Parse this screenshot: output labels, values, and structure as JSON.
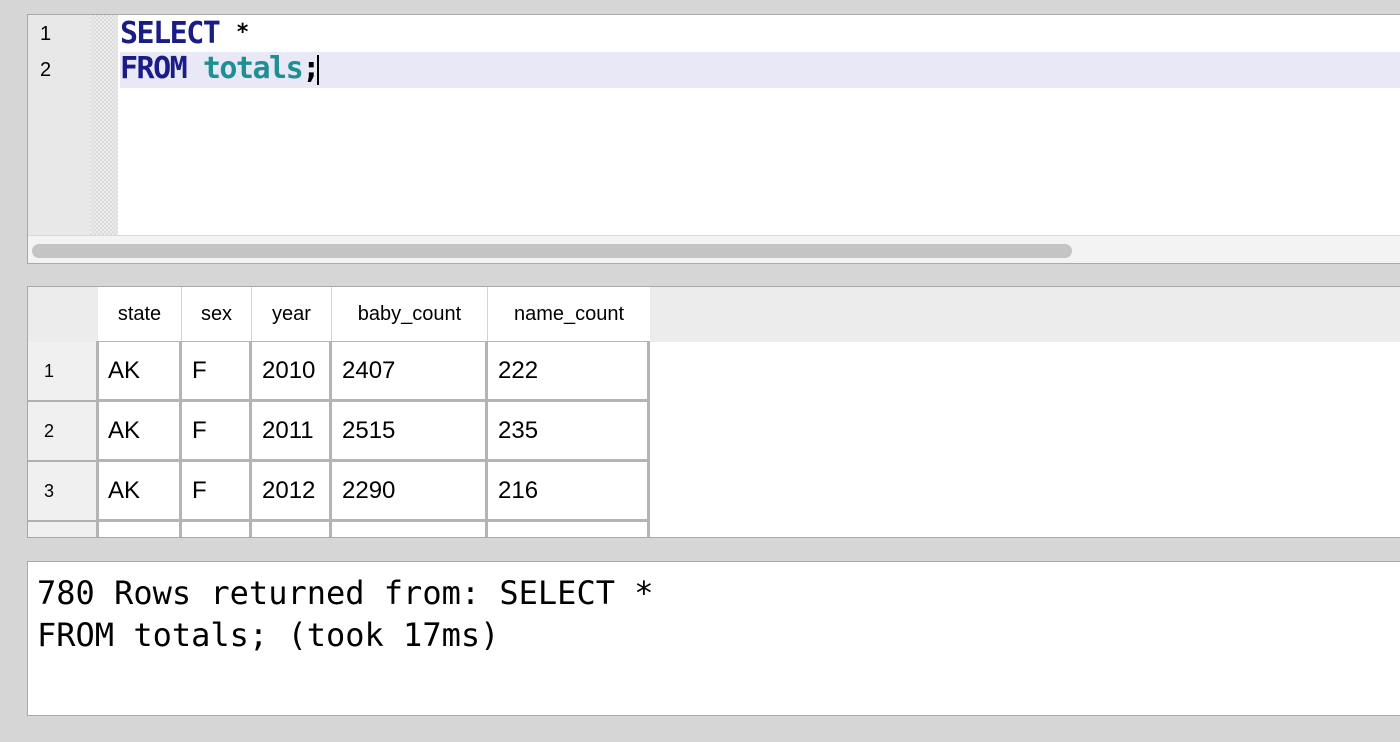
{
  "editor": {
    "line_numbers": [
      "1",
      "2"
    ],
    "lines": [
      {
        "keyword": "SELECT",
        "rest": "*"
      },
      {
        "keyword": "FROM",
        "identifier": "totals",
        "punct": ";"
      }
    ]
  },
  "results": {
    "columns": [
      "state",
      "sex",
      "year",
      "baby_count",
      "name_count"
    ],
    "rows": [
      {
        "num": "1",
        "cells": [
          "AK",
          "F",
          "2010",
          "2407",
          "222"
        ]
      },
      {
        "num": "2",
        "cells": [
          "AK",
          "F",
          "2011",
          "2515",
          "235"
        ]
      },
      {
        "num": "3",
        "cells": [
          "AK",
          "F",
          "2012",
          "2290",
          "216"
        ]
      }
    ]
  },
  "message": {
    "line1": "780 Rows returned from: SELECT *",
    "line2": "FROM totals; (took 17ms)"
  },
  "colors": {
    "keyword": "#1b1d86",
    "identifier": "#1f8f93",
    "current_line": "#e8e8f6"
  }
}
